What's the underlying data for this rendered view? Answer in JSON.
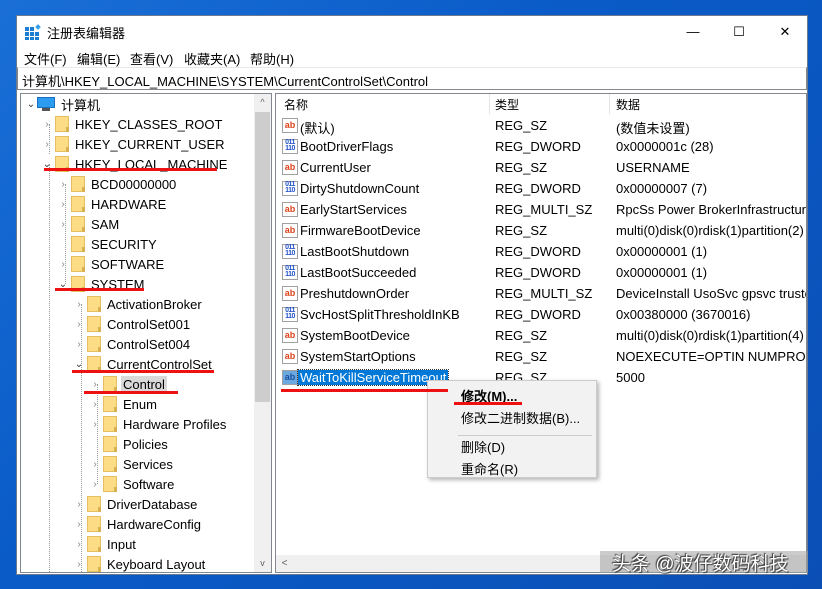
{
  "window": {
    "title": "注册表编辑器",
    "controls": {
      "minimize": "—",
      "maximize": "☐",
      "close": "✕"
    }
  },
  "menu": [
    {
      "label": "文件(F)"
    },
    {
      "label": "编辑(E)"
    },
    {
      "label": "查看(V)"
    },
    {
      "label": "收藏夹(A)"
    },
    {
      "label": "帮助(H)"
    }
  ],
  "address": "计算机\\HKEY_LOCAL_MACHINE\\SYSTEM\\CurrentControlSet\\Control",
  "tree": {
    "root": "计算机",
    "items": [
      {
        "label": "HKEY_CLASSES_ROOT",
        "expander": "›"
      },
      {
        "label": "HKEY_CURRENT_USER",
        "expander": "›"
      },
      {
        "label": "HKEY_LOCAL_MACHINE",
        "expander": "⌄"
      },
      {
        "label": "BCD00000000",
        "expander": "›"
      },
      {
        "label": "HARDWARE",
        "expander": "›"
      },
      {
        "label": "SAM",
        "expander": "›"
      },
      {
        "label": "SECURITY",
        "expander": ""
      },
      {
        "label": "SOFTWARE",
        "expander": "›"
      },
      {
        "label": "SYSTEM",
        "expander": "⌄"
      },
      {
        "label": "ActivationBroker",
        "expander": "›"
      },
      {
        "label": "ControlSet001",
        "expander": "›"
      },
      {
        "label": "ControlSet004",
        "expander": "›"
      },
      {
        "label": "CurrentControlSet",
        "expander": "⌄"
      },
      {
        "label": "Control",
        "expander": "›"
      },
      {
        "label": "Enum",
        "expander": "›"
      },
      {
        "label": "Hardware Profiles",
        "expander": "›"
      },
      {
        "label": "Policies",
        "expander": ""
      },
      {
        "label": "Services",
        "expander": "›"
      },
      {
        "label": "Software",
        "expander": "›"
      },
      {
        "label": "DriverDatabase",
        "expander": "›"
      },
      {
        "label": "HardwareConfig",
        "expander": "›"
      },
      {
        "label": "Input",
        "expander": "›"
      },
      {
        "label": "Keyboard Layout",
        "expander": "›"
      }
    ],
    "selected": "Control"
  },
  "list": {
    "columns": {
      "name": "名称",
      "type": "类型",
      "data": "数据"
    },
    "rows": [
      {
        "icon": "ab",
        "name": "(默认)",
        "type": "REG_SZ",
        "data": "(数值未设置)"
      },
      {
        "icon": "bin",
        "name": "BootDriverFlags",
        "type": "REG_DWORD",
        "data": "0x0000001c (28)"
      },
      {
        "icon": "ab",
        "name": "CurrentUser",
        "type": "REG_SZ",
        "data": "USERNAME"
      },
      {
        "icon": "bin",
        "name": "DirtyShutdownCount",
        "type": "REG_DWORD",
        "data": "0x00000007 (7)"
      },
      {
        "icon": "ab",
        "name": "EarlyStartServices",
        "type": "REG_MULTI_SZ",
        "data": "RpcSs Power BrokerInfrastructur"
      },
      {
        "icon": "ab",
        "name": "FirmwareBootDevice",
        "type": "REG_SZ",
        "data": "multi(0)disk(0)rdisk(1)partition(2)"
      },
      {
        "icon": "bin",
        "name": "LastBootShutdown",
        "type": "REG_DWORD",
        "data": "0x00000001 (1)"
      },
      {
        "icon": "bin",
        "name": "LastBootSucceeded",
        "type": "REG_DWORD",
        "data": "0x00000001 (1)"
      },
      {
        "icon": "ab",
        "name": "PreshutdownOrder",
        "type": "REG_MULTI_SZ",
        "data": "DeviceInstall UsoSvc gpsvc truste"
      },
      {
        "icon": "bin",
        "name": "SvcHostSplitThresholdInKB",
        "type": "REG_DWORD",
        "data": "0x00380000 (3670016)"
      },
      {
        "icon": "ab",
        "name": "SystemBootDevice",
        "type": "REG_SZ",
        "data": "multi(0)disk(0)rdisk(1)partition(4)"
      },
      {
        "icon": "ab",
        "name": "SystemStartOptions",
        "type": "REG_SZ",
        "data": " NOEXECUTE=OPTIN  NUMPROC"
      },
      {
        "icon": "ab",
        "name": "WaitToKillServiceTimeout",
        "type": "REG_SZ",
        "data": "5000"
      }
    ],
    "selected": "WaitToKillServiceTimeout"
  },
  "context_menu": {
    "items": [
      {
        "label": "修改(M)...",
        "bold": true
      },
      {
        "label": "修改二进制数据(B)..."
      },
      {
        "label": "删除(D)"
      },
      {
        "label": "重命名(R)"
      }
    ]
  },
  "scroll": {
    "up": "^",
    "down": "v",
    "left": "<"
  },
  "watermark": "头条 @波仔数码科技",
  "colors": {
    "highlight": "#ee1111",
    "selection": "#0078d7",
    "desktop": "#0a5bc8"
  }
}
